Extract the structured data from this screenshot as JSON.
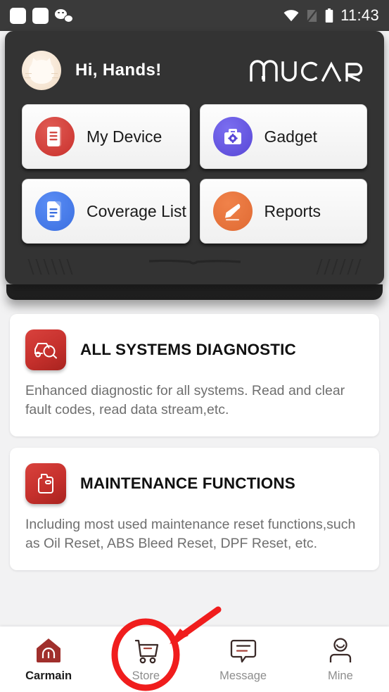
{
  "statusbar": {
    "time": "11:43",
    "left_icons": [
      "app-notification-icon",
      "app-notification-icon",
      "wechat-icon"
    ],
    "right_icons": [
      "wifi-icon",
      "no-sim-icon",
      "battery-icon"
    ]
  },
  "device_panel": {
    "greeting": "Hi,  Hands!",
    "brand_logo": "MUCAR",
    "avatar_alt": "cat-avatar",
    "buttons": [
      {
        "label": "My Device",
        "icon": "device-document-icon",
        "color": "#c9302c"
      },
      {
        "label": "Gadget",
        "icon": "toolbox-gear-icon",
        "color": "#5847d6"
      },
      {
        "label": "Coverage List",
        "icon": "list-document-icon",
        "color": "#3b6fe0"
      },
      {
        "label": "Reports",
        "icon": "pencil-edit-icon",
        "color": "#e06a33"
      }
    ]
  },
  "content": {
    "cards": [
      {
        "title": "ALL SYSTEMS DIAGNOSTIC",
        "desc": "Enhanced diagnostic for all systems. Read and clear fault codes, read data stream,etc.",
        "icon": "car-scan-icon",
        "icon_color": "#c5302c"
      },
      {
        "title": "MAINTENANCE FUNCTIONS",
        "desc": "Including most used maintenance reset functions,such as Oil Reset, ABS Bleed Reset, DPF Reset, etc.",
        "icon": "oil-can-icon",
        "icon_color": "#c5302c"
      }
    ]
  },
  "bottom_nav": {
    "items": [
      {
        "label": "Carmain",
        "icon": "home-icon",
        "active": true
      },
      {
        "label": "Store",
        "icon": "cart-icon",
        "active": false
      },
      {
        "label": "Message",
        "icon": "message-icon",
        "active": false
      },
      {
        "label": "Mine",
        "icon": "person-icon",
        "active": false
      }
    ]
  },
  "annotation": {
    "highlight_color": "#f01d1d",
    "target": "Store",
    "shapes": [
      "circle-highlight",
      "arrow-pointer"
    ]
  }
}
